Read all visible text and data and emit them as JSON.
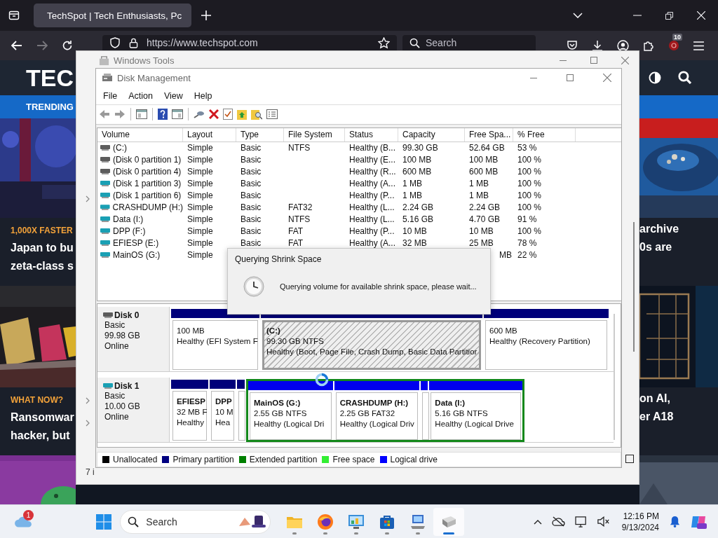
{
  "browser": {
    "tab": {
      "title": "TechSpot | Tech Enthusiasts, Pc",
      "selected": true
    },
    "url": "https://www.techspot.com",
    "search_placeholder": "Search",
    "extension_badge": "10"
  },
  "site": {
    "logo": "TEC",
    "nav_label": "TRENDING",
    "left_articles": [
      {
        "tag": "1,000X FASTER",
        "lines": [
          "Japan to bu",
          "zeta-class s"
        ]
      },
      {
        "tag": "WHAT NOW?",
        "lines": [
          "Ransomwar",
          "hacker, but"
        ]
      }
    ],
    "right_articles": [
      {
        "lines": [
          "archive",
          "0s are"
        ]
      },
      {
        "lines": [
          "on AI,",
          "er A18"
        ]
      }
    ]
  },
  "windows_tools": {
    "title": "Windows Tools",
    "status": "7 i"
  },
  "disk_management": {
    "title": "Disk Management",
    "menu": [
      "File",
      "Action",
      "View",
      "Help"
    ],
    "columns": [
      "Volume",
      "Layout",
      "Type",
      "File System",
      "Status",
      "Capacity",
      "Free Spa...",
      "% Free"
    ],
    "rows": [
      {
        "volume": "(C:)",
        "layout": "Simple",
        "type": "Basic",
        "file_system": "NTFS",
        "status": "Healthy (B...",
        "capacity": "99.30 GB",
        "free_space": "52.64 GB",
        "percent_free": "53 %",
        "color": "#5c5c5c"
      },
      {
        "volume": "(Disk 0 partition 1)",
        "layout": "Simple",
        "type": "Basic",
        "status": "Healthy (E...",
        "capacity": "100 MB",
        "free_space": "100 MB",
        "percent_free": "100 %",
        "color": "#5c5c5c"
      },
      {
        "volume": "(Disk 0 partition 4)",
        "layout": "Simple",
        "type": "Basic",
        "status": "Healthy (R...",
        "capacity": "600 MB",
        "free_space": "600 MB",
        "percent_free": "100 %",
        "color": "#5c5c5c"
      },
      {
        "volume": "(Disk 1 partition 3)",
        "layout": "Simple",
        "type": "Basic",
        "status": "Healthy (A...",
        "capacity": "1 MB",
        "free_space": "1 MB",
        "percent_free": "100 %",
        "color": "#1aa0b4"
      },
      {
        "volume": "(Disk 1 partition 6)",
        "layout": "Simple",
        "type": "Basic",
        "status": "Healthy (P...",
        "capacity": "1 MB",
        "free_space": "1 MB",
        "percent_free": "100 %",
        "color": "#1aa0b4"
      },
      {
        "volume": "CRASHDUMP (H:)",
        "layout": "Simple",
        "type": "Basic",
        "file_system": "FAT32",
        "status": "Healthy (L...",
        "capacity": "2.24 GB",
        "free_space": "2.24 GB",
        "percent_free": "100 %",
        "color": "#1aa0b4"
      },
      {
        "volume": "Data (I:)",
        "layout": "Simple",
        "type": "Basic",
        "file_system": "NTFS",
        "status": "Healthy (L...",
        "capacity": "5.16 GB",
        "free_space": "4.70 GB",
        "percent_free": "91 %",
        "color": "#1aa0b4"
      },
      {
        "volume": "DPP (F:)",
        "layout": "Simple",
        "type": "Basic",
        "file_system": "FAT",
        "status": "Healthy (P...",
        "capacity": "10 MB",
        "free_space": "10 MB",
        "percent_free": "100 %",
        "color": "#1aa0b4"
      },
      {
        "volume": "EFIESP (E:)",
        "layout": "Simple",
        "type": "Basic",
        "file_system": "FAT",
        "status": "Healthy (A...",
        "capacity": "32 MB",
        "free_space": "25 MB",
        "percent_free": "78 %",
        "color": "#1aa0b4"
      },
      {
        "volume": "MainOS (G:)",
        "layout": "Simple",
        "free_space": "MB",
        "percent_free": "22 %",
        "color": "#1aa0b4"
      }
    ],
    "disks": [
      {
        "name": "Disk 0",
        "lines": [
          "Basic",
          "99.98 GB",
          "Online"
        ],
        "color": "#5c5c5c",
        "partitions": [
          {
            "kind": "primary",
            "selected": false,
            "lines": [
              "100 MB",
              "Healthy (EFI System F"
            ]
          },
          {
            "kind": "primary",
            "selected": true,
            "name": "(C:)",
            "lines": [
              "99.30 GB NTFS",
              "Healthy (Boot, Page File, Crash Dump, Basic Data Partitior"
            ]
          },
          {
            "kind": "primary",
            "selected": false,
            "lines": [
              "600 MB",
              "Healthy (Recovery Partition)"
            ]
          }
        ]
      },
      {
        "name": "Disk 1",
        "lines": [
          "Basic",
          "10.00 GB",
          "Online"
        ],
        "color": "#1aa0b4",
        "partitions": [
          {
            "kind": "primary",
            "selected": false,
            "name": "EFIESP",
            "lines": [
              "32 MB F",
              "Healthy"
            ]
          },
          {
            "kind": "primary",
            "selected": false,
            "name": "DPP",
            "lines": [
              "10 M",
              "Hea"
            ]
          },
          {
            "kind": "primary",
            "selected": false
          },
          {
            "kind": "extended",
            "selected": false,
            "children": [
              {
                "kind": "logical",
                "selected": false,
                "name": "MainOS  (G:)",
                "lines": [
                  "2.55 GB NTFS",
                  "Healthy (Logical Dri"
                ]
              },
              {
                "kind": "logical",
                "selected": false,
                "name": "CRASHDUMP  (H:)",
                "lines": [
                  "2.25 GB FAT32",
                  "Healthy (Logical Driv"
                ]
              },
              {
                "kind": "logical",
                "selected": false
              },
              {
                "kind": "logical",
                "selected": false,
                "name": "Data  (I:)",
                "lines": [
                  "5.16 GB NTFS",
                  "Healthy (Logical Drive"
                ]
              }
            ]
          }
        ]
      }
    ],
    "legend": [
      {
        "label": "Unallocated",
        "color": "#000000"
      },
      {
        "label": "Primary partition",
        "color": "#000080"
      },
      {
        "label": "Extended partition",
        "color": "#008000"
      },
      {
        "label": "Free space",
        "color": "#33ee33"
      },
      {
        "label": "Logical drive",
        "color": "#0000ff"
      }
    ]
  },
  "dialog": {
    "title": "Querying Shrink Space",
    "message": "Querying volume for available shrink space, please wait..."
  },
  "taskbar": {
    "weather_badge": "1",
    "search_placeholder": "Search",
    "apps": [
      {
        "kind": "folder",
        "active": false
      },
      {
        "kind": "globe",
        "active": false
      },
      {
        "kind": "panel",
        "active": false
      },
      {
        "kind": "store",
        "active": false
      },
      {
        "kind": "computer",
        "active": false
      },
      {
        "kind": "drive",
        "active": true
      }
    ],
    "time": "12:16 PM",
    "date": "9/13/2024"
  }
}
